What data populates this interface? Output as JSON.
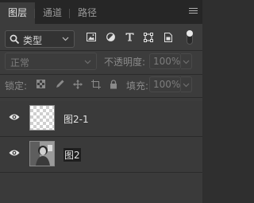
{
  "tabs": [
    {
      "label": "图层",
      "active": true
    },
    {
      "label": "通道",
      "active": false
    },
    {
      "label": "路径",
      "active": false
    }
  ],
  "filter": {
    "kind_label": "类型",
    "icons": [
      "image-filter-icon",
      "adjustment-filter-icon",
      "type-filter-icon",
      "shape-filter-icon",
      "smart-object-filter-icon"
    ],
    "filter_on": true
  },
  "blend": {
    "mode": "正常",
    "opacity_label": "不透明度:",
    "opacity_value": "100%"
  },
  "lock": {
    "label": "锁定:",
    "icons": [
      "lock-transparent-pixels-icon",
      "lock-image-pixels-icon",
      "lock-position-icon",
      "lock-artboard-icon",
      "lock-all-icon"
    ],
    "fill_label": "填充:",
    "fill_value": "100%"
  },
  "layers": [
    {
      "name": "图2-1",
      "visible": true,
      "thumbnail": "transparent"
    },
    {
      "name": "图2",
      "visible": true,
      "thumbnail": "photo",
      "selected_text": true
    }
  ],
  "colors": {
    "panel_bg": "#3c3c3c",
    "tabbar_bg": "#262626",
    "text": "#e2e2e2"
  }
}
